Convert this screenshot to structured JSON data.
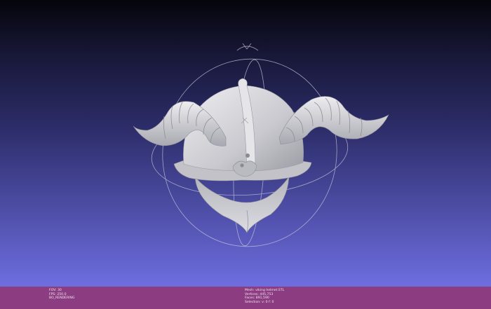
{
  "viewer": {
    "background_top": "#05050b",
    "background_bottom": "#6e6ee0",
    "info_bar_color": "#8c3c80",
    "model_color": "#cfcfd4",
    "trackball_color": "#c8c8dc"
  },
  "info_left": {
    "fov": "FOV: 30",
    "fps": "FPS: 250.0",
    "renderer": "BO_RENDERING"
  },
  "info_right": {
    "mesh": "Mesh: viking helmet.STL",
    "vertices": "Vertices: 445,753",
    "faces": "Faces: 891,590",
    "selection": "Selection: v: 0 f: 0"
  }
}
